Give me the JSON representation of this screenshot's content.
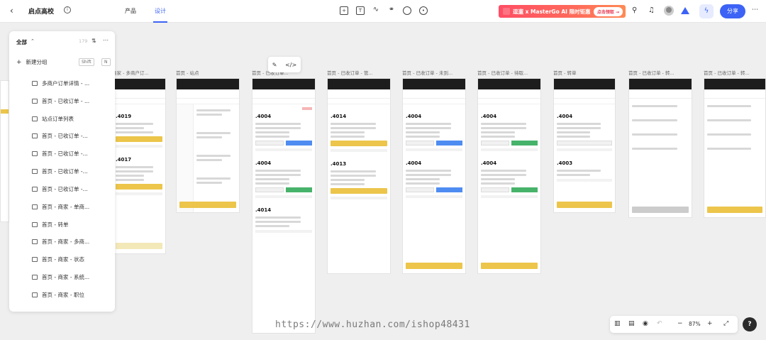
{
  "header": {
    "team_name": "启点高校",
    "tabs": [
      {
        "label": "产品"
      },
      {
        "label": "设计"
      }
    ],
    "promo_text": "逗遛 x MasterGo AI 限时钜惠",
    "promo_cta": "点击领取 →",
    "share_label": "分享"
  },
  "sidebar": {
    "filter_label": "全部",
    "count": "179",
    "new_group_label": "新建分组",
    "shortcut_key1": "Shift",
    "shortcut_key2": "N",
    "pages": [
      {
        "label": "多商户订单详情 - ..."
      },
      {
        "label": "首页 - 已收订单 - ..."
      },
      {
        "label": "站点订单列表"
      },
      {
        "label": "首页 - 已收订单 -..."
      },
      {
        "label": "首页 - 已收订单 -..."
      },
      {
        "label": "首页 - 已收订单 -..."
      },
      {
        "label": "首页 - 已收订单 -..."
      },
      {
        "label": "首页 - 商家 - 单商..."
      },
      {
        "label": "首页 - 转单"
      },
      {
        "label": "首页 - 商家 - 多商..."
      },
      {
        "label": "首页 - 商家 - 状态"
      },
      {
        "label": "首页 - 商家 - 系统..."
      },
      {
        "label": "首页 - 商家 - 职位"
      }
    ]
  },
  "canvas": {
    "frame_labels": [
      "商家 - 多商户订...",
      "首页 - 站点",
      "首页 - 已收订单...",
      "首页 - 已收订单 - 管...",
      "首页 - 已收订单 - 未到...",
      "首页 - 已收订单 - 待取...",
      "首页 - 转单",
      "首页 - 已收订单 - 转...",
      "首页 - 已收订单 - 转..."
    ],
    "order_nums": [
      ".4019",
      ".4017",
      ".4004",
      ".4004",
      ".4014",
      ".4013",
      ".4014",
      ".4004",
      ".4004",
      ".4004",
      ".4004",
      ".4004",
      ".4003"
    ]
  },
  "zoom": {
    "value": "87%"
  },
  "watermark": "https://www.huzhan.com/ishop48431"
}
